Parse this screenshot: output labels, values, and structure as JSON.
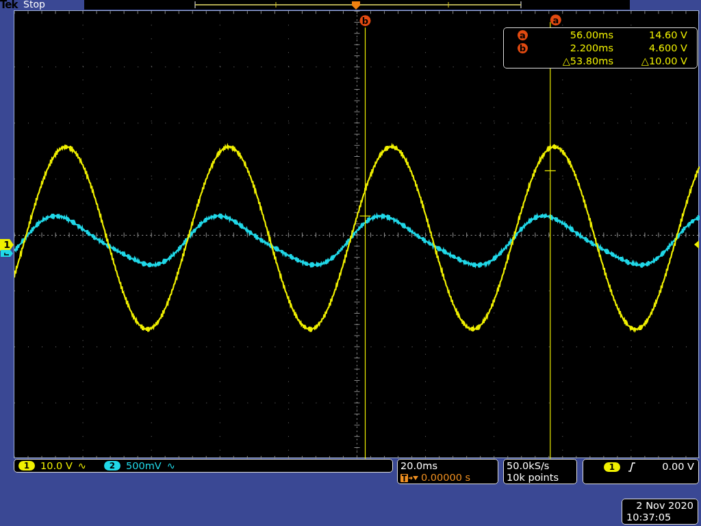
{
  "header": {
    "brand": "Tek",
    "status": "Stop"
  },
  "cursor_markers": [
    {
      "label": "b"
    },
    {
      "label": "a"
    }
  ],
  "cursors": [
    {
      "label": "a",
      "time": "56.00ms",
      "value": "14.60 V"
    },
    {
      "label": "b",
      "time": "2.200ms",
      "value": "4.600 V"
    }
  ],
  "cursor_delta": {
    "time": "△53.80ms",
    "value": "△10.00 V"
  },
  "channel_markers": [
    {
      "number": "1"
    }
  ],
  "channels": [
    {
      "number": "1",
      "scale": "10.0 V",
      "coupling": "∿",
      "color": "#f0f000"
    },
    {
      "number": "2",
      "scale": "500mV",
      "coupling": "∿",
      "color": "#20d8e8"
    }
  ],
  "timebase": {
    "scale": "20.0ms",
    "delay": "0.00000 s"
  },
  "acquisition": {
    "rate": "50.0kS/s",
    "points": "10k points"
  },
  "trigger": {
    "source": "1",
    "level": "0.00 V"
  },
  "timestamp": {
    "date": "2 Nov 2020",
    "time": "10:37:05"
  }
}
